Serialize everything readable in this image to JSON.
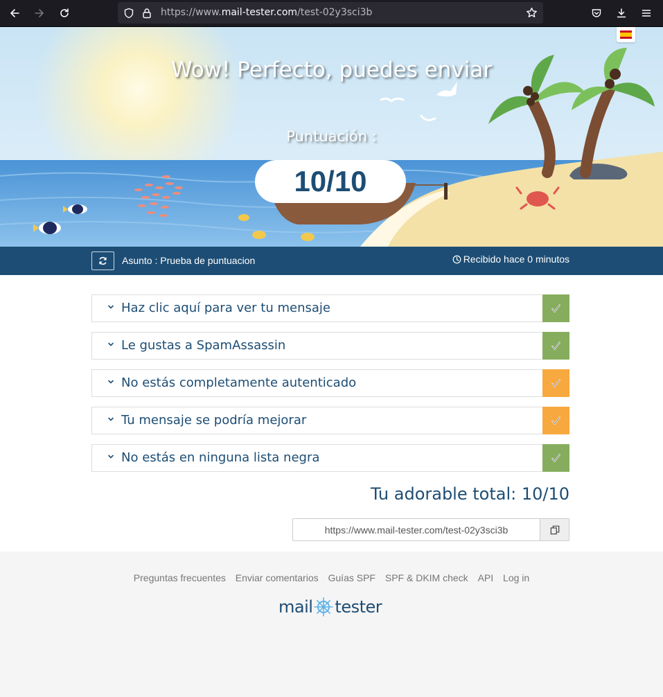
{
  "browser": {
    "url_prefix": "https://www.",
    "url_host": "mail-tester.com",
    "url_path": "/test-02y3sci3b",
    "icons": [
      "back-icon",
      "forward-icon",
      "reload-icon",
      "shield-icon",
      "lock-icon",
      "star-icon",
      "pocket-icon",
      "download-icon",
      "menu-icon"
    ]
  },
  "hero": {
    "title": "Wow! Perfecto, puedes enviar",
    "score_label": "Puntuación :",
    "score": "10/10",
    "language_flag": "es-flag-icon"
  },
  "subject_bar": {
    "subject": "Asunto : Prueba de puntuacion",
    "received": "Recibido hace 0 minutos"
  },
  "results": [
    {
      "label": "Haz clic aquí para ver tu mensaje",
      "status": "green"
    },
    {
      "label": "Le gustas a SpamAssassin",
      "status": "green"
    },
    {
      "label": "No estás completamente autenticado",
      "status": "orange"
    },
    {
      "label": "Tu mensaje se podría mejorar",
      "status": "orange"
    },
    {
      "label": "No estás en ninguna lista negra",
      "status": "green"
    }
  ],
  "total": "Tu adorable total: 10/10",
  "share_url": "https://www.mail-tester.com/test-02y3sci3b",
  "footer": {
    "links": [
      "Preguntas frecuentes",
      "Enviar comentarios",
      "Guías SPF",
      "SPF & DKIM check",
      "API",
      "Log in"
    ],
    "logo_left": "mail",
    "logo_right": "tester"
  },
  "colors": {
    "brand": "#1d4d74",
    "ok": "#86ad5d",
    "warn": "#f7a83e"
  }
}
